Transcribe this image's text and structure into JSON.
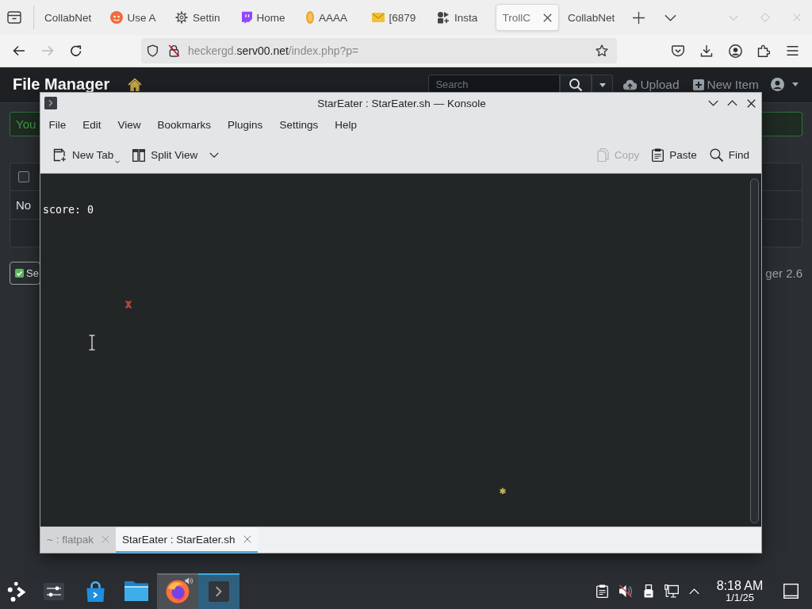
{
  "browser": {
    "tabs": [
      {
        "label": "CollabNet",
        "selected": false
      },
      {
        "label": "Use A",
        "selected": false
      },
      {
        "label": "Settin",
        "selected": false
      },
      {
        "label": "Home",
        "selected": false
      },
      {
        "label": "AAAA",
        "selected": false
      },
      {
        "label": "[6879",
        "selected": false
      },
      {
        "label": "Insta",
        "selected": false
      },
      {
        "label": "TrollC",
        "selected": true
      },
      {
        "label": "CollabNet",
        "selected": false
      }
    ],
    "nav_buttons": [
      {
        "disabled": false
      },
      {
        "disabled": true
      },
      {
        "disabled": false
      }
    ],
    "address": {
      "subdomain": "heckergd.",
      "domain": "serv00.net",
      "path": "/index.php?p="
    }
  },
  "web_page": {
    "title": "File Manager",
    "search": {
      "placeholder": "Search"
    },
    "actions": [
      "Upload",
      "New Item"
    ],
    "alert": "You",
    "table": {
      "select_all_checked": false,
      "message": "No"
    },
    "select_button": "Se",
    "footer": "ger 2.6"
  },
  "konsole": {
    "title": "StarEater : StarEater.sh — Konsole",
    "menu": [
      "File",
      "Edit",
      "View",
      "Bookmarks",
      "Plugins",
      "Settings",
      "Help"
    ],
    "toolbar": [
      {
        "label": "New Tab",
        "disabled": false
      },
      {
        "label": "Split View",
        "disabled": false
      },
      {
        "label": "Copy",
        "disabled": true
      },
      {
        "label": "Paste",
        "disabled": false
      },
      {
        "label": "Find",
        "disabled": false
      }
    ],
    "terminal": {
      "lines": [
        "score: 0"
      ],
      "glyphs": [
        {
          "text": "x",
          "color": "#b4473b"
        },
        {
          "text": "*",
          "color": "#c8b45a"
        }
      ]
    },
    "tabs": [
      {
        "label": "~ : flatpak",
        "selected": false
      },
      {
        "label": "StarEater : StarEater.sh",
        "selected": true
      }
    ]
  },
  "taskbar": {
    "tasks": [
      {
        "running": false,
        "selected": false,
        "audio": false
      },
      {
        "running": false,
        "selected": false,
        "audio": false
      },
      {
        "running": false,
        "selected": false,
        "audio": false
      },
      {
        "running": true,
        "selected": false,
        "audio": true
      },
      {
        "running": true,
        "selected": true,
        "audio": false
      }
    ],
    "clock": {
      "time": "8:18 AM",
      "date": "1/1/25"
    }
  }
}
